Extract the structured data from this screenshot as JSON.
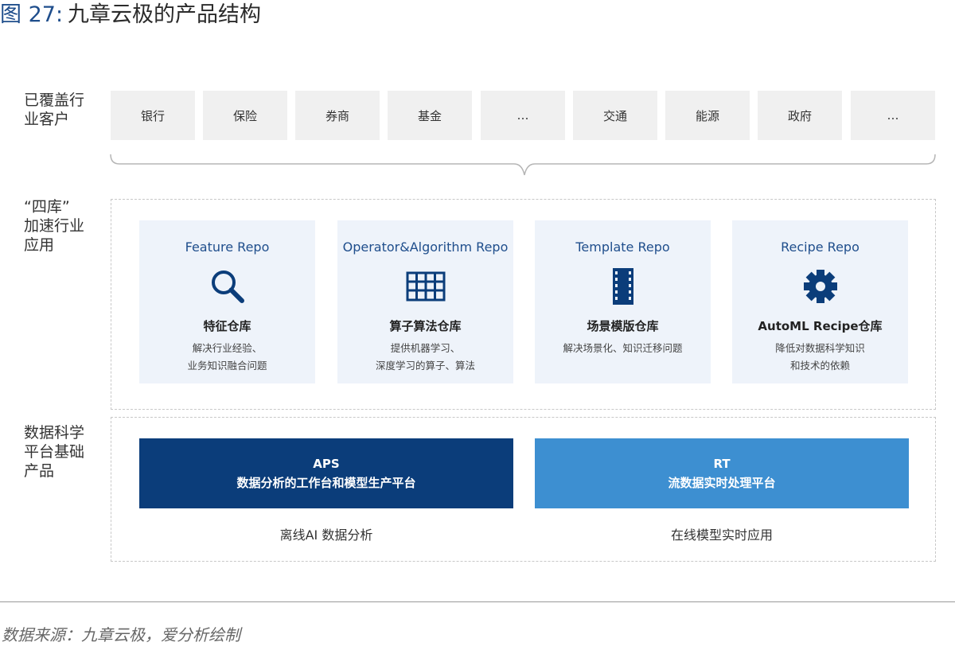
{
  "title": {
    "figure": "图 27:",
    "name": "九章云极的产品结构"
  },
  "rows": {
    "customers": "已覆盖行\n业客户",
    "apps": "“四库”\n加速行业\n应用",
    "platform": "数据科学\n平台基础\n产品"
  },
  "customers": [
    "银行",
    "保险",
    "券商",
    "基金",
    "…",
    "交通",
    "能源",
    "政府",
    "…"
  ],
  "repos": [
    {
      "eng": "Feature Repo",
      "icon": "magnifier-icon",
      "cn": "特征仓库",
      "desc": "解决行业经验、\n业务知识融合问题"
    },
    {
      "eng": "Operator&Algorithm Repo",
      "icon": "grid-table-icon",
      "cn": "算子算法仓库",
      "desc": "提供机器学习、\n深度学习的算子、算法"
    },
    {
      "eng": "Template Repo",
      "icon": "film-strip-icon",
      "cn": "场景模版仓库",
      "desc": "解决场景化、知识迁移问题"
    },
    {
      "eng": "Recipe Repo",
      "icon": "gear-icon",
      "cn": "AutoML Recipe仓库",
      "desc": "降低对数据科学知识\n和技术的依赖"
    }
  ],
  "platforms": [
    {
      "name": "APS",
      "desc": "数据分析的工作台和模型生产平台",
      "caption": "离线AI 数据分析",
      "color": "#0b3d7a"
    },
    {
      "name": "RT",
      "desc": "流数据实时处理平台",
      "caption": "在线模型实时应用",
      "color": "#3d8fd1"
    }
  ],
  "source": "数据来源：九章云极，爱分析绘制",
  "colors": {
    "accent": "#1f4e8c",
    "card_bg": "#eef3fa",
    "customer_bg": "#f0f0f0"
  }
}
